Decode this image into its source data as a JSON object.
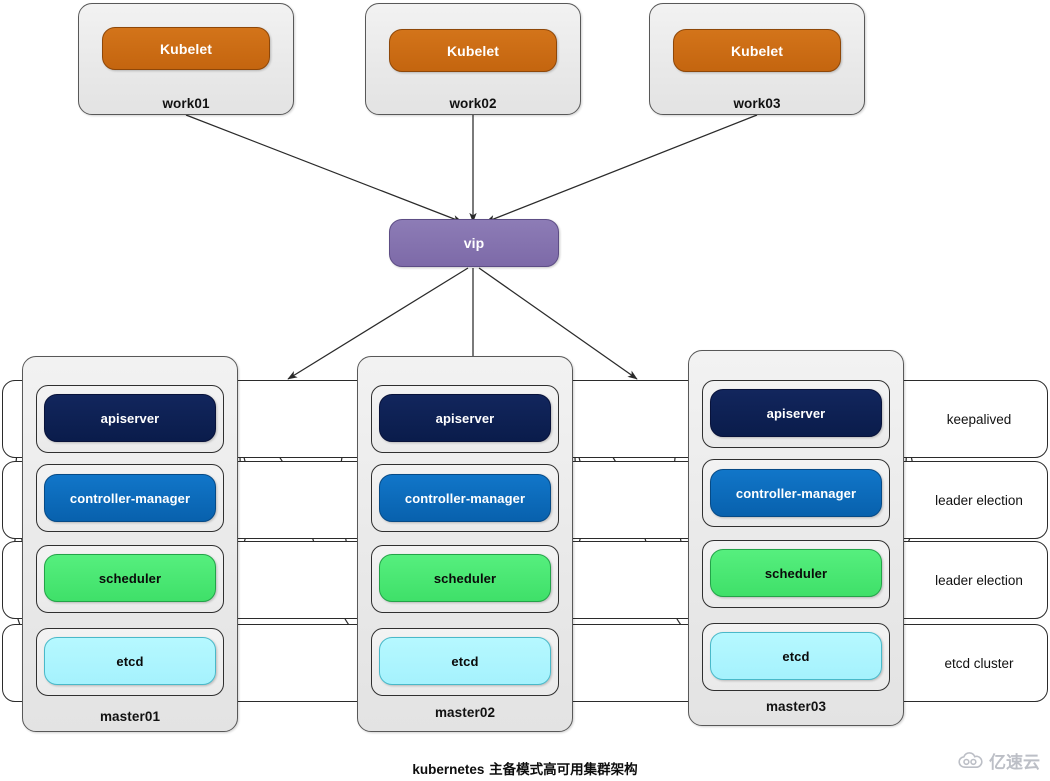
{
  "diagram": {
    "caption_en": "kubernetes",
    "caption_zh": " 主备模式高可用集群架构",
    "watermark": "亿速云"
  },
  "workers": [
    {
      "id": "work01",
      "host_label": "work01",
      "component": "Kubelet"
    },
    {
      "id": "work02",
      "host_label": "work02",
      "component": "Kubelet"
    },
    {
      "id": "work03",
      "host_label": "work03",
      "component": "Kubelet"
    }
  ],
  "vip": {
    "label": "vip"
  },
  "masters": [
    {
      "id": "master01",
      "host_label": "master01",
      "components": {
        "apiserver": "apiserver",
        "controller_manager": "controller-manager",
        "scheduler": "scheduler",
        "etcd": "etcd"
      }
    },
    {
      "id": "master02",
      "host_label": "master02",
      "components": {
        "apiserver": "apiserver",
        "controller_manager": "controller-manager",
        "scheduler": "scheduler",
        "etcd": "etcd"
      }
    },
    {
      "id": "master03",
      "host_label": "master03",
      "components": {
        "apiserver": "apiserver",
        "controller_manager": "controller-manager",
        "scheduler": "scheduler",
        "etcd": "etcd"
      }
    }
  ],
  "bands": [
    {
      "id": "apiserver-band",
      "label": "keepalived"
    },
    {
      "id": "controller-band",
      "label": "leader election"
    },
    {
      "id": "scheduler-band",
      "label": "leader election"
    },
    {
      "id": "etcd-band",
      "label": "etcd cluster"
    }
  ],
  "colors": {
    "kubelet": "#c4650f",
    "vip": "#7d6aa8",
    "apiserver": "#0a1c4b",
    "controller_manager": "#0861ad",
    "scheduler": "#3fe069",
    "etcd": "#a5f2fd",
    "host_fill": "#e9e9e9",
    "band_stroke": "#2b2b2b",
    "edge": "#2a2a2a"
  }
}
